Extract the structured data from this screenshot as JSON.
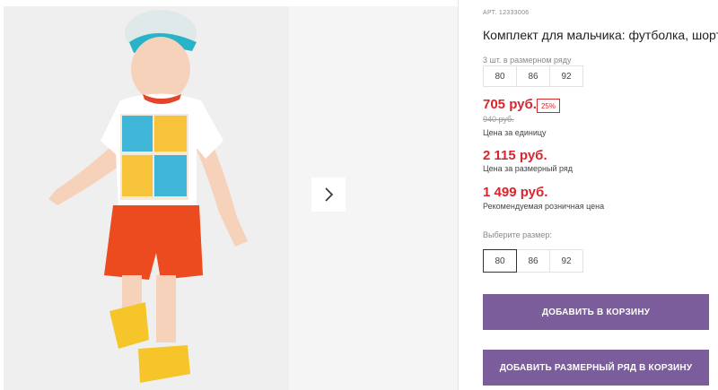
{
  "gallery": {
    "next_icon": "chevron-right-icon"
  },
  "product": {
    "sku": "АРТ. 12333006",
    "title": "Комплект для мальчика: футболка, шорты",
    "pack_label": "3 шт. в размерном ряду",
    "pack_sizes": [
      "80",
      "86",
      "92"
    ],
    "price": "705 руб.",
    "discount": "25%",
    "old_price": "940 руб.",
    "price_caption": "Цена за единицу",
    "pack_price": "2 115 руб.",
    "pack_price_caption": "Цена за размерный ряд",
    "rrp": "1 499 руб.",
    "rrp_caption": "Рекомендуемая розничная цена",
    "choose_size_label": "Выберите размер:",
    "sizes": [
      "80",
      "86",
      "92"
    ],
    "selected_size": "80",
    "add_to_cart": "ДОБАВИТЬ В КОРЗИНУ",
    "add_pack_to_cart": "ДОБАВИТЬ РАЗМЕРНЫЙ РЯД В КОРЗИНУ"
  },
  "colors": {
    "price_red": "#d8262d",
    "button_purple": "#7b5d9c"
  }
}
